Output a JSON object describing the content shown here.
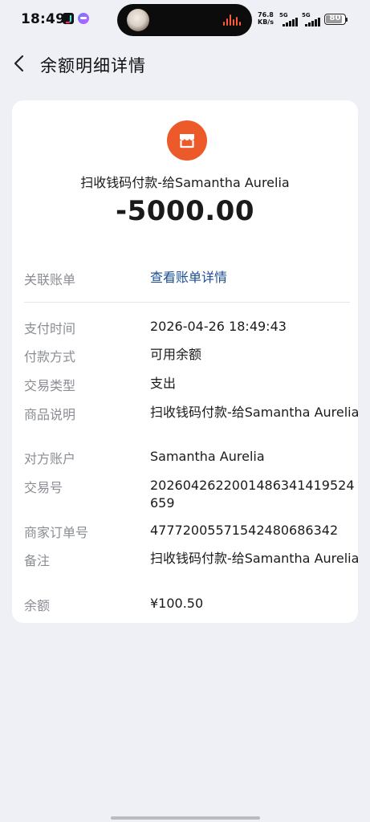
{
  "status_bar": {
    "time": "18:49",
    "net_speed_value": "76.8",
    "net_speed_unit": "KB/s",
    "signal1_label": "5G",
    "signal2_label": "5G",
    "battery": "80"
  },
  "nav": {
    "back_icon": "chevron-left-icon",
    "title": "余额明细详情"
  },
  "header": {
    "merchant_icon": "shop-icon",
    "merchant_color": "#ed5a2a",
    "merchant": "扫收钱码付款-给Samantha Aurelia",
    "amount": "-5000.00"
  },
  "related_bill": {
    "label": "关联账单",
    "link_text": "查看账单详情",
    "link_color": "#1c4f93"
  },
  "details": [
    {
      "label": "支付时间",
      "value": "2026-04-26 18:49:43"
    },
    {
      "label": "付款方式",
      "value": "可用余额"
    },
    {
      "label": "交易类型",
      "value": "支出"
    },
    {
      "label": "商品说明",
      "value": "扫收钱码付款-给Samantha Aurelia"
    },
    {
      "label": "对方账户",
      "value": "Samantha Aurelia"
    },
    {
      "label": "交易号",
      "value": "2026042622001486341419524659"
    },
    {
      "label": "商家订单号",
      "value": "4777200557154248068634​2"
    },
    {
      "label": "备注",
      "value": "扫收钱码付款-给Samantha Aurelia"
    },
    {
      "label": "余额",
      "value": "¥100.50"
    }
  ]
}
